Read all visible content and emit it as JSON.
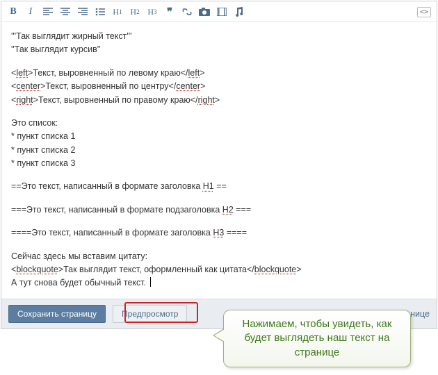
{
  "toolbar": {
    "bold": "B",
    "italic": "I",
    "h1": "H",
    "h1s": "1",
    "h2": "H",
    "h2s": "2",
    "h3": "H",
    "h3s": "3",
    "quote": "❝",
    "src": "<>"
  },
  "editor": {
    "bold_sample": "'''Так выглядит жирный текст'''",
    "italic_sample": "''Так выглядит курсив''",
    "align_left_open": "<",
    "align_left_tag": "left",
    "align_left_close": ">",
    "align_left_text": "Текст, выровненный по левому краю",
    "align_left_endopen": "</",
    "align_left_endtag": "left",
    "align_left_endclose": ">",
    "align_center_open": "<",
    "align_center_tag": "center",
    "align_center_close": ">",
    "align_center_text": "Текст, выровненный по центру",
    "align_center_endopen": "</",
    "align_center_endtag": "center",
    "align_center_endclose": ">",
    "align_right_open": "<",
    "align_right_tag": "right",
    "align_right_close": ">",
    "align_right_text": "Текст, выровненный по правому краю",
    "align_right_endopen": "</",
    "align_right_endtag": "right",
    "align_right_endclose": ">",
    "list_intro": "Это список:",
    "list_1": "* пункт списка 1",
    "list_2": "* пункт списка 2",
    "list_3": "* пункт списка 3",
    "h1_pre": "==Это текст, написанный в формате заголовка ",
    "h1_mark": "H1",
    "h1_post": " ==",
    "h2_pre": "===Это текст, написанный в формате подзаголовка ",
    "h2_mark": "H2",
    "h2_post": " ===",
    "h3_pre": "====Это текст, написанный в формате заголовка ",
    "h3_mark": "H3",
    "h3_post": " ====",
    "quote_intro": "Сейчас здесь мы вставим цитату:",
    "bq_open": "<",
    "bq_tag": "blockquote",
    "bq_close": ">",
    "bq_text": "Так выглядит текст, оформленный как цитата",
    "bq_endopen": "</",
    "bq_endtag": "blockquote",
    "bq_endclose": ">",
    "plain_after": "А тут снова будет обычный текст. "
  },
  "footer": {
    "save": "Сохранить страницу",
    "preview": "Предпросмотр",
    "back": "к странице"
  },
  "callout": {
    "text": "Нажимаем, чтобы увидеть, как будет выглядеть наш текст на странице"
  }
}
